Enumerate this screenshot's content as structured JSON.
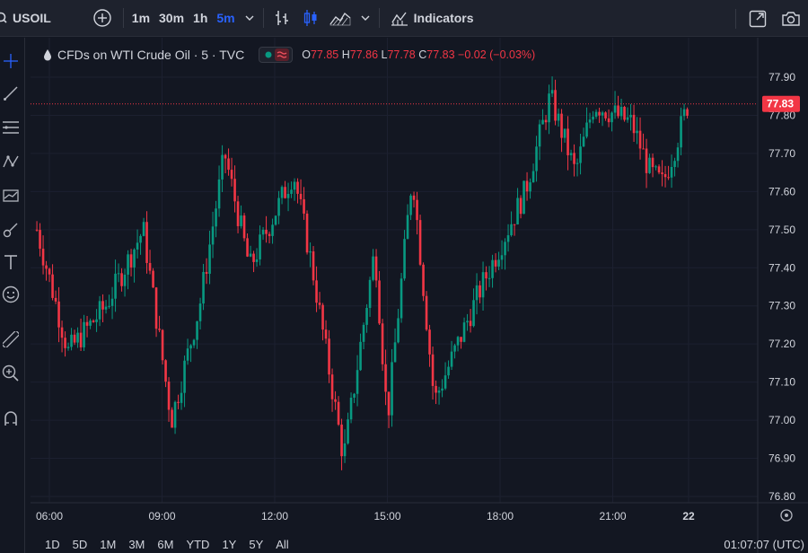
{
  "toolbar": {
    "symbol": "USOIL",
    "intervals": [
      {
        "label": "1m",
        "active": false
      },
      {
        "label": "30m",
        "active": false
      },
      {
        "label": "1h",
        "active": false
      },
      {
        "label": "5m",
        "active": true
      }
    ],
    "indicators_label": "Indicators"
  },
  "legend": {
    "title": "CFDs on WTI Crude Oil · 5 · TVC",
    "open_key": "O",
    "open": "77.85",
    "high_key": "H",
    "high": "77.86",
    "low_key": "L",
    "low": "77.78",
    "close_key": "C",
    "close": "77.83",
    "change": "−0.02 (−0.03%)"
  },
  "colors": {
    "background": "#131722",
    "up": "#089981",
    "down": "#f23645",
    "accent": "#2962ff",
    "price_line": "#f23645"
  },
  "bottom": {
    "ranges": [
      "1D",
      "5D",
      "1M",
      "3M",
      "6M",
      "YTD",
      "1Y",
      "5Y",
      "All"
    ],
    "clock": "01:07:07 (UTC)"
  },
  "chart_data": {
    "type": "candlestick",
    "price_axis": {
      "ticks": [
        "77.90",
        "77.80",
        "77.70",
        "77.60",
        "77.50",
        "77.40",
        "77.30",
        "77.20",
        "77.10",
        "77.00",
        "76.90",
        "76.80"
      ],
      "range": [
        76.78,
        77.93
      ],
      "current_price_label": "77.83",
      "current_price": 77.83
    },
    "time_axis": {
      "ticks": [
        "06:00",
        "09:00",
        "12:00",
        "15:00",
        "18:00",
        "21:00",
        "22"
      ]
    },
    "key_closes": [
      {
        "time": "05:40",
        "price": 77.5
      },
      {
        "time": "06:30",
        "price": 77.18
      },
      {
        "time": "07:30",
        "price": 77.3
      },
      {
        "time": "08:30",
        "price": 77.5
      },
      {
        "time": "09:15",
        "price": 77.0
      },
      {
        "time": "10:00",
        "price": 77.3
      },
      {
        "time": "10:40",
        "price": 77.7
      },
      {
        "time": "11:20",
        "price": 77.4
      },
      {
        "time": "12:30",
        "price": 77.65
      },
      {
        "time": "13:00",
        "price": 77.4
      },
      {
        "time": "13:50",
        "price": 76.9
      },
      {
        "time": "14:40",
        "price": 77.45
      },
      {
        "time": "15:00",
        "price": 77.0
      },
      {
        "time": "15:40",
        "price": 77.65
      },
      {
        "time": "16:15",
        "price": 77.05
      },
      {
        "time": "17:30",
        "price": 77.35
      },
      {
        "time": "18:40",
        "price": 77.6
      },
      {
        "time": "19:20",
        "price": 77.85
      },
      {
        "time": "20:00",
        "price": 77.65
      },
      {
        "time": "20:30",
        "price": 77.83
      },
      {
        "time": "21:30",
        "price": 77.78
      },
      {
        "time": "22:00",
        "price": 77.65
      },
      {
        "time": "22:20",
        "price": 77.62
      },
      {
        "time": "22:40",
        "price": 77.72
      },
      {
        "time": "23:00",
        "price": 77.83
      }
    ]
  }
}
